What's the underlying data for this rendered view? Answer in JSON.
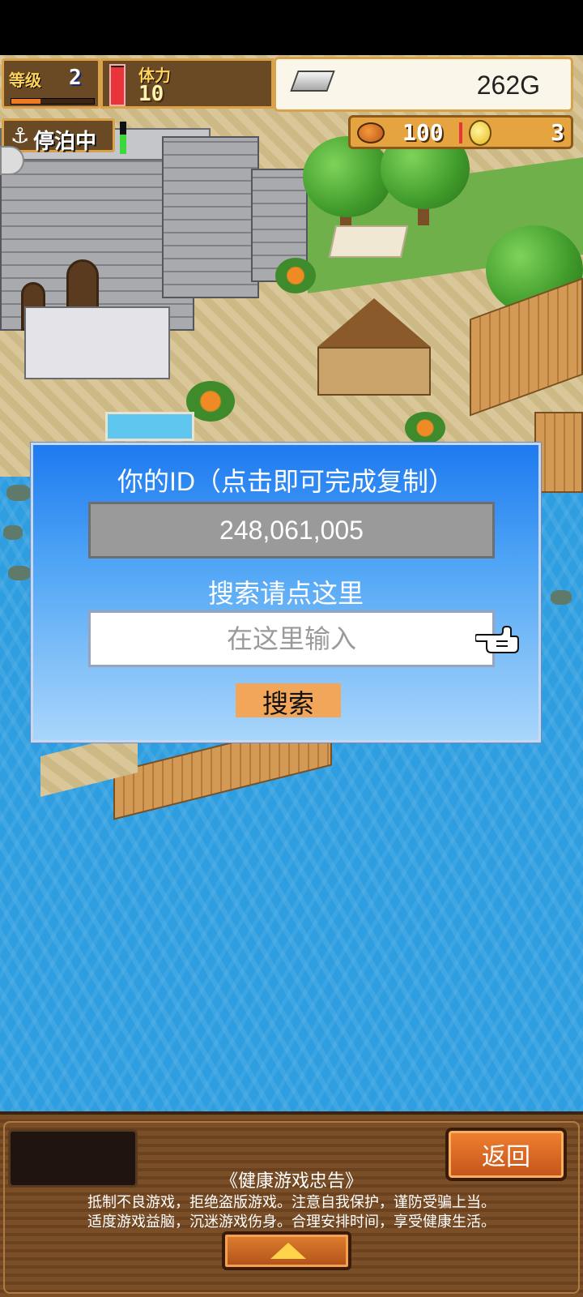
{
  "hud": {
    "level_label": "等级",
    "level_value": "2",
    "xp_fraction": 0.35,
    "stamina_label": "体力",
    "stamina_value": "10",
    "stamina_fraction": 0.95,
    "money": "262G",
    "anchor_icon": "⚓",
    "dock_status": "停泊中",
    "food_value": "100",
    "coin_value": "3",
    "accent_color": "#d9a24a"
  },
  "dialog": {
    "title": "你的ID（点击即可完成复制）",
    "id_value": "248,061,005",
    "search_hint": "搜索请点这里",
    "search_placeholder": "在这里输入",
    "search_value": "",
    "search_button": "搜索"
  },
  "footer": {
    "back_button": "返回",
    "notice_title": "《健康游戏忠告》",
    "notice_line1": "抵制不良游戏，拒绝盗版游戏。注意自我保护，谨防受骗上当。",
    "notice_line2": "适度游戏益脑，沉迷游戏伤身。合理安排时间，享受健康生活。",
    "expand_icon": "triangle-up-icon"
  }
}
